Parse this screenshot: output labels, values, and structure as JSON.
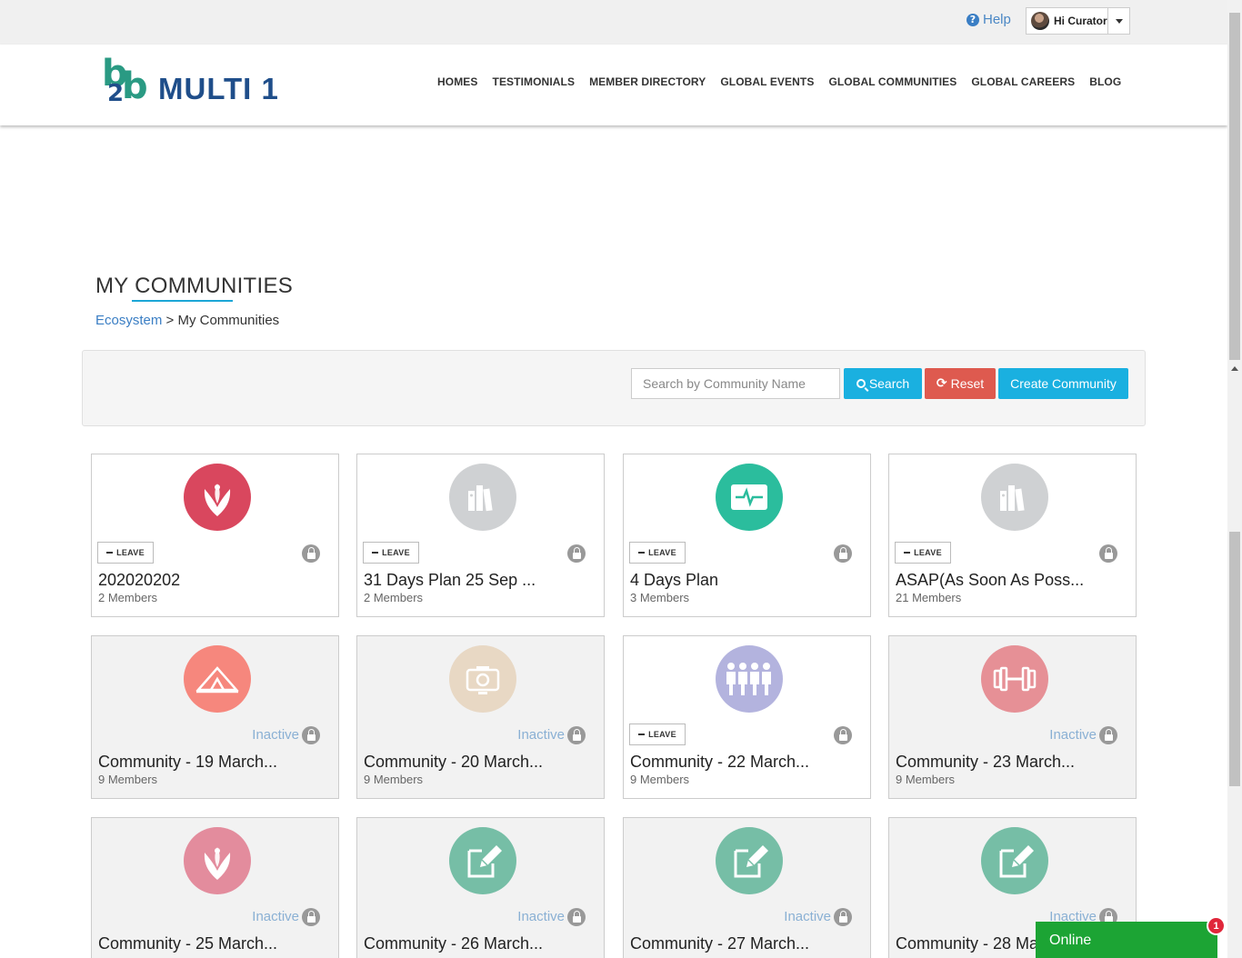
{
  "topbar": {
    "help_label": "Help",
    "help_icon": "question-circle-icon",
    "user_label": "Hi Curator"
  },
  "logo": {
    "mark": "b2b",
    "text": "MULTI 1"
  },
  "nav": [
    "HOMES",
    "TESTIMONIALS",
    "MEMBER DIRECTORY",
    "GLOBAL EVENTS",
    "GLOBAL COMMUNITIES",
    "GLOBAL CAREERS",
    "BLOG"
  ],
  "page": {
    "title": "MY COMMUNITIES",
    "breadcrumb_link": "Ecosystem",
    "breadcrumb_sep": " > ",
    "breadcrumb_current": "My Communities"
  },
  "search": {
    "placeholder": "Search by Community Name",
    "search_label": "Search",
    "reset_label": "Reset",
    "create_label": "Create Community"
  },
  "leave_label": "LEAVE",
  "inactive_label": "Inactive",
  "colors": {
    "brand_blue": "#1f4e8a",
    "brand_green": "#2a9a83",
    "button_blue": "#1ab0e0",
    "button_red": "#de5a4f",
    "online_green": "#1ca434"
  },
  "communities": [
    {
      "name": "202020202",
      "members": "2 Members",
      "status": "member",
      "icon": "lotus-icon",
      "color": "#d9475e"
    },
    {
      "name": "31 Days Plan 25 Sep ...",
      "members": "2 Members",
      "status": "member",
      "icon": "books-icon",
      "color": "#cfd1d3"
    },
    {
      "name": "4 Days Plan",
      "members": "3 Members",
      "status": "member",
      "icon": "heartbeat-monitor-icon",
      "color": "#2bbd9d"
    },
    {
      "name": "ASAP(As Soon As Poss...",
      "members": "21 Members",
      "status": "member",
      "icon": "books-icon",
      "color": "#cfd1d3"
    },
    {
      "name": "Community - 19 March...",
      "members": "9 Members",
      "status": "inactive",
      "icon": "tent-icon",
      "color": "#f6877d"
    },
    {
      "name": "Community - 20 March...",
      "members": "9 Members",
      "status": "inactive",
      "icon": "camera-icon",
      "color": "#e8d8c4"
    },
    {
      "name": "Community - 22 March...",
      "members": "9 Members",
      "status": "member",
      "icon": "people-icon",
      "color": "#b3b3de"
    },
    {
      "name": "Community - 23 March...",
      "members": "9 Members",
      "status": "inactive",
      "icon": "dumbbell-icon",
      "color": "#e69096"
    },
    {
      "name": "Community - 25 March...",
      "members": "",
      "status": "inactive",
      "icon": "lotus-icon",
      "color": "#e38c9d"
    },
    {
      "name": "Community - 26 March...",
      "members": "",
      "status": "inactive",
      "icon": "edit-document-icon",
      "color": "#76bea6"
    },
    {
      "name": "Community - 27 March...",
      "members": "",
      "status": "inactive",
      "icon": "edit-document-icon",
      "color": "#76bea6"
    },
    {
      "name": "Community - 28 Ma",
      "members": "",
      "status": "inactive",
      "icon": "edit-document-icon",
      "color": "#76bea6"
    }
  ],
  "chat": {
    "label": "Online",
    "badge": "1"
  }
}
